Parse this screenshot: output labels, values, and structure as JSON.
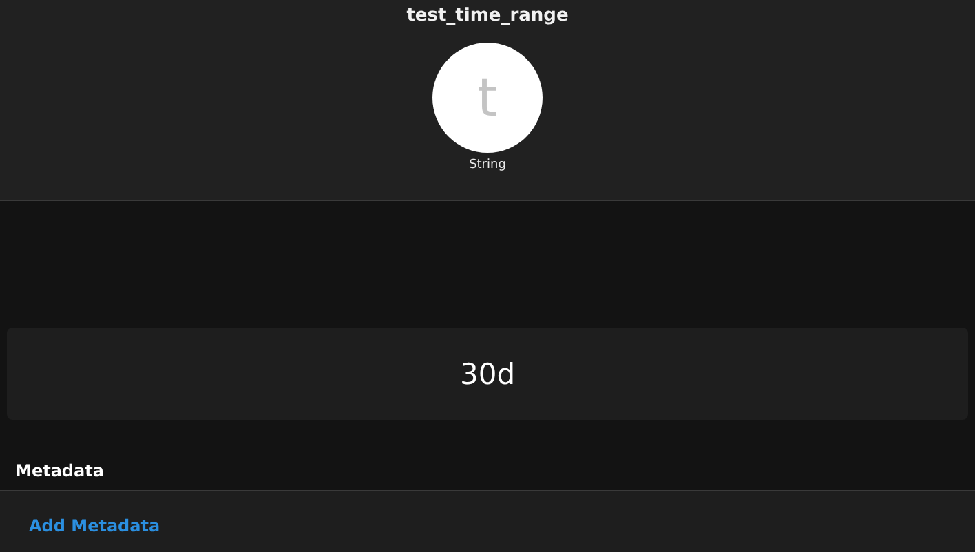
{
  "header": {
    "title": "test_time_range",
    "avatar_letter": "t",
    "type_label": "String"
  },
  "value": "30d",
  "metadata": {
    "title": "Metadata",
    "add_link": "Add Metadata"
  }
}
